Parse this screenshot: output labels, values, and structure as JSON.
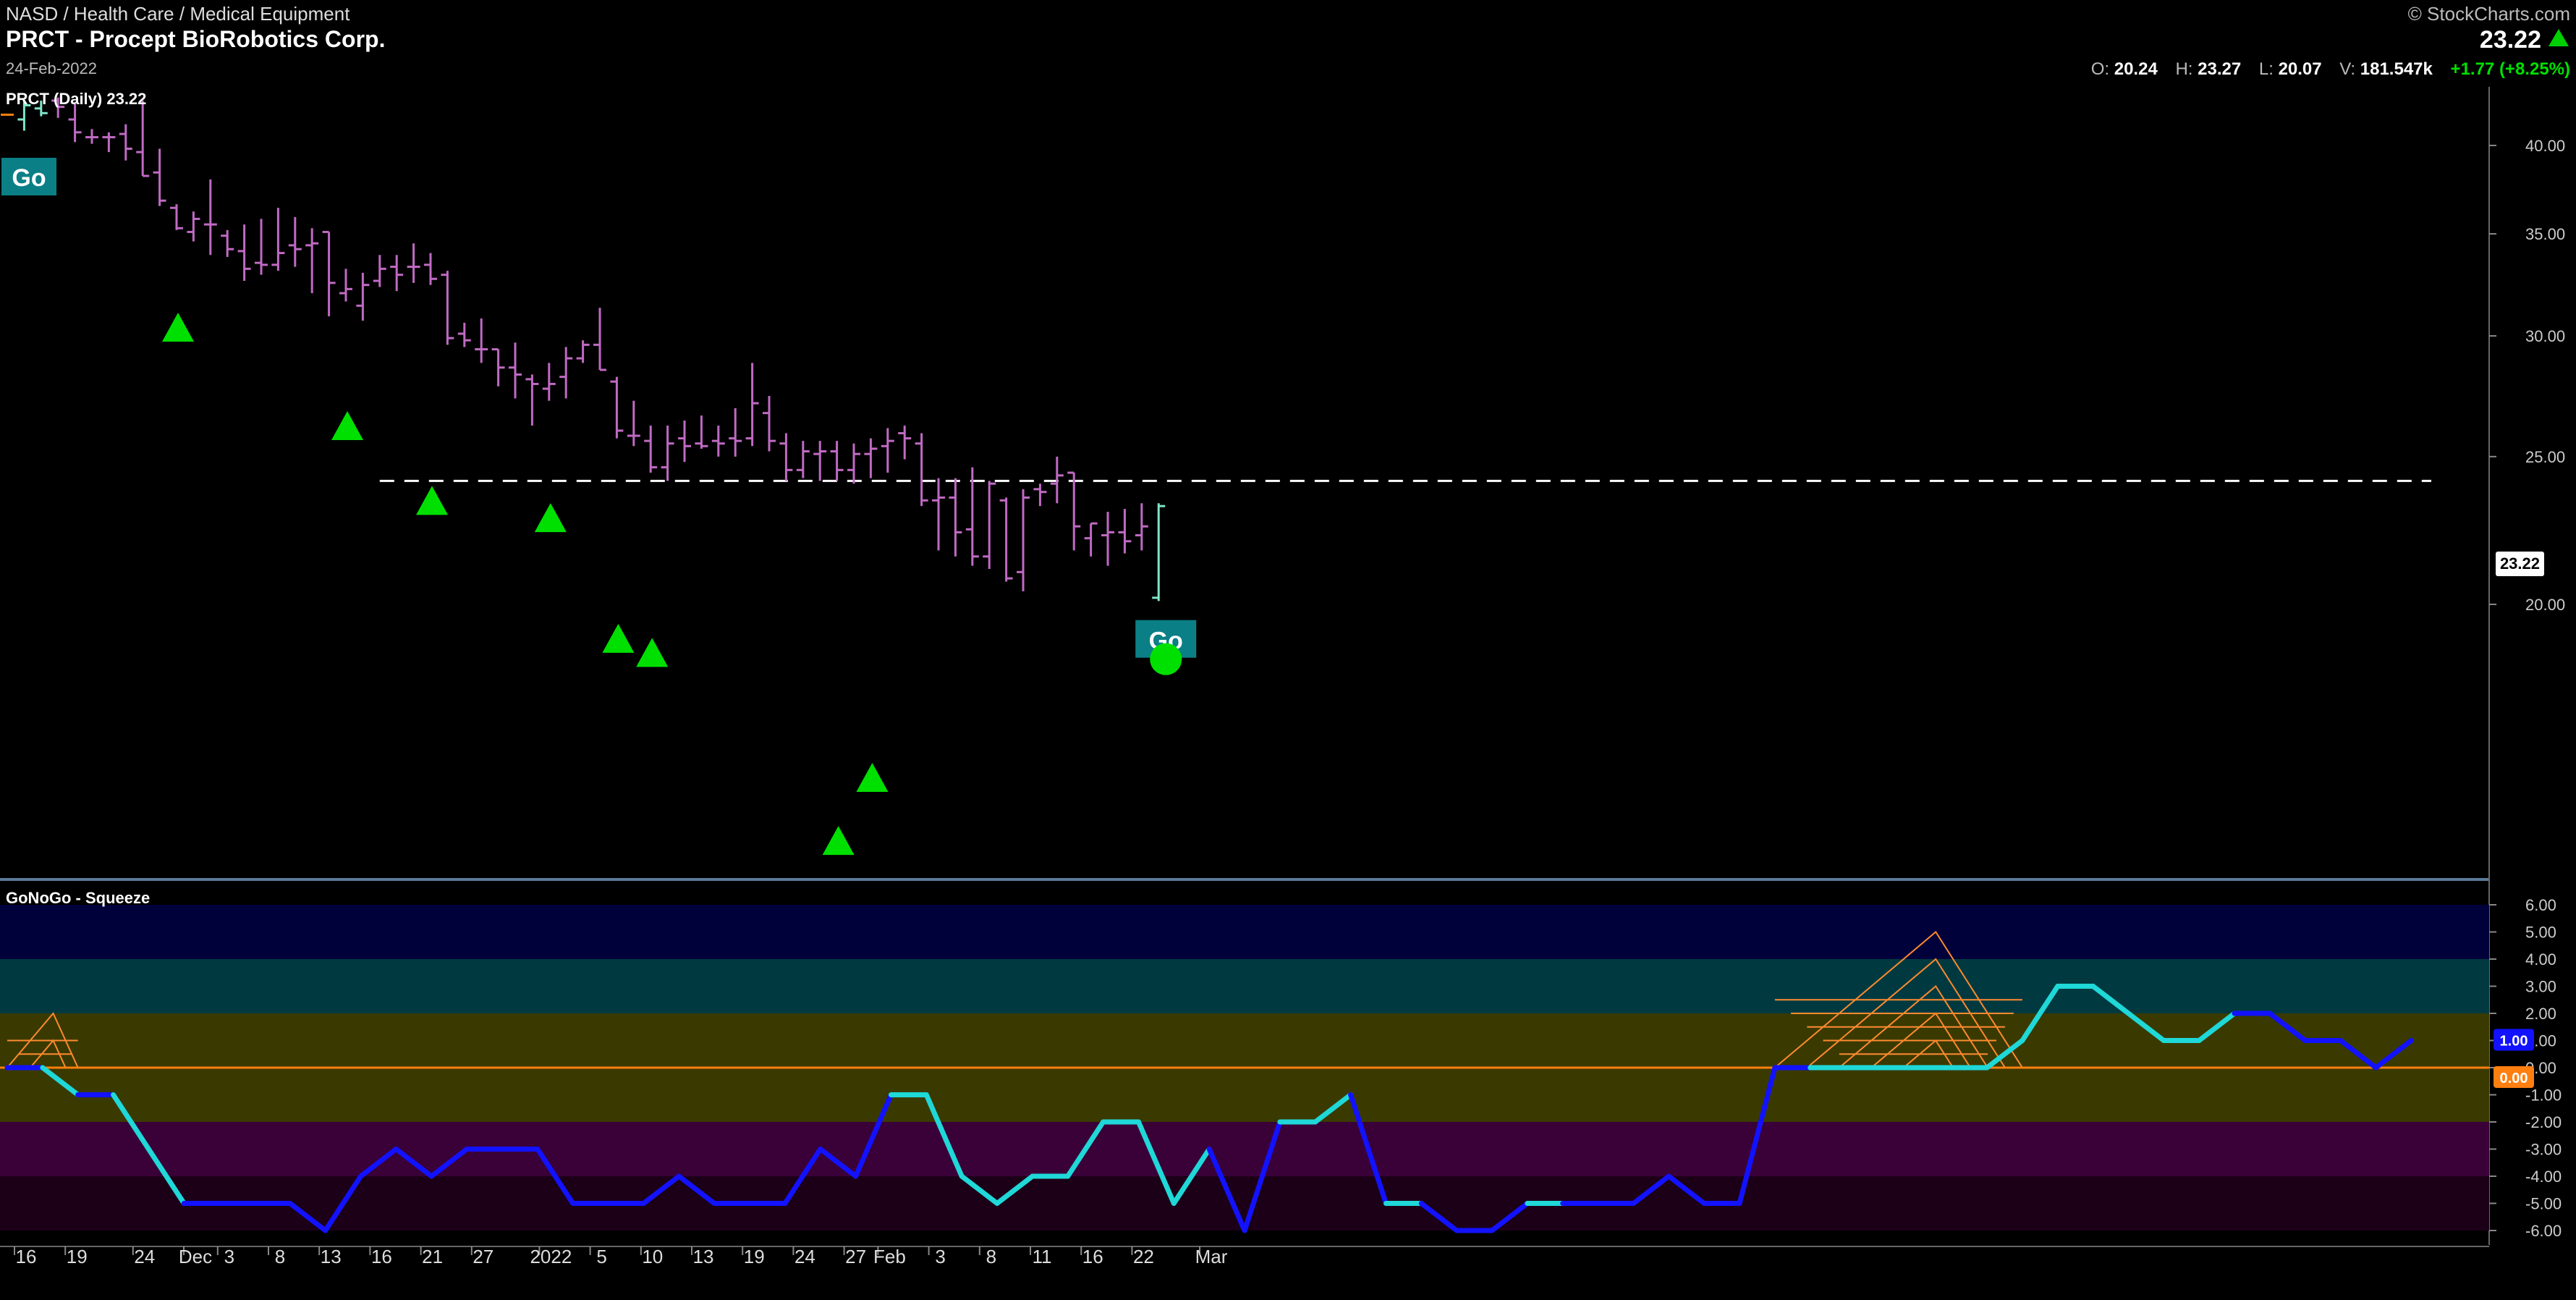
{
  "header": {
    "breadcrumb": "NASD / Health Care / Medical Equipment",
    "title": "PRCT - Procept BioRobotics Corp.",
    "date": "24-Feb-2022",
    "brand": "© StockCharts.com",
    "last_price": "23.22",
    "ohlcv": {
      "open_label": "O:",
      "open": "20.24",
      "high_label": "H:",
      "high": "23.27",
      "low_label": "L:",
      "low": "20.07",
      "volume_label": "V:",
      "volume": "181.547k",
      "change": "+1.77 (+8.25%)"
    }
  },
  "price_panel": {
    "label": "PRCT (Daily) 23.22",
    "go_badge": "Go",
    "last_price_box": "23.22"
  },
  "oscillator_panel": {
    "label": "GoNoGo - Squeeze",
    "value_box": "1.00",
    "zero_box": "0.00"
  },
  "colors": {
    "bar_pink": "#c06ac4",
    "bar_pink_light": "#e79ae6",
    "bar_aqua": "#7fe6c8",
    "go_badge": "#0b7f86",
    "triangle": "#00e000",
    "osc_blue": "#1212ff",
    "osc_cyan": "#1fd8d8",
    "zero_line": "#ff7f10",
    "squeeze": "#ff8a30"
  },
  "chart_data": [
    {
      "type": "ohlc",
      "title": "PRCT (Daily) 23.22",
      "x_tick_labels": [
        "16",
        "19",
        "24",
        "Dec",
        "3",
        "8",
        "13",
        "16",
        "21",
        "27",
        "2022",
        "5",
        "10",
        "13",
        "19",
        "24",
        "27",
        "Feb",
        "3",
        "8",
        "11",
        "16",
        "22",
        "Mar"
      ],
      "y_ticks": [
        "20.00",
        "25.00",
        "30.00",
        "35.00",
        "40.00"
      ],
      "y_scale": "log",
      "ylim": [
        13.2,
        43.7
      ],
      "resistance_line": 24.1,
      "bars": [
        {
          "date": "2021-11-16",
          "o": 41.9,
          "h": 41.9,
          "l": 41.9,
          "c": 41.9,
          "color": "orange"
        },
        {
          "date": "2021-11-17",
          "o": 41.6,
          "h": 42.8,
          "l": 40.9,
          "c": 42.5,
          "color": "aqua"
        },
        {
          "date": "2021-11-18",
          "o": 42.3,
          "h": 42.8,
          "l": 41.8,
          "c": 42.0,
          "color": "aqua"
        },
        {
          "date": "2021-11-19",
          "o": 42.8,
          "h": 43.0,
          "l": 41.7,
          "c": 42.4,
          "color": "pink"
        },
        {
          "date": "2021-11-22",
          "o": 41.6,
          "h": 42.7,
          "l": 40.2,
          "c": 40.8,
          "color": "pink"
        },
        {
          "date": "2021-11-23",
          "o": 40.5,
          "h": 41.0,
          "l": 40.1,
          "c": 40.5,
          "color": "pink"
        },
        {
          "date": "2021-11-24",
          "o": 40.5,
          "h": 40.8,
          "l": 39.6,
          "c": 40.5,
          "color": "pink"
        },
        {
          "date": "2021-11-26",
          "o": 40.7,
          "h": 41.3,
          "l": 39.1,
          "c": 39.8,
          "color": "pink"
        },
        {
          "date": "2021-11-29",
          "o": 39.6,
          "h": 42.8,
          "l": 38.2,
          "c": 38.2,
          "color": "pink"
        },
        {
          "date": "2021-11-30",
          "o": 38.4,
          "h": 39.8,
          "l": 36.5,
          "c": 36.8,
          "color": "pink"
        },
        {
          "date": "2021-12-01",
          "o": 36.4,
          "h": 36.6,
          "l": 35.2,
          "c": 35.3,
          "color": "pink"
        },
        {
          "date": "2021-12-02",
          "o": 35.1,
          "h": 36.2,
          "l": 34.6,
          "c": 35.8,
          "color": "pink"
        },
        {
          "date": "2021-12-03",
          "o": 35.5,
          "h": 38.0,
          "l": 33.9,
          "c": 35.5,
          "color": "pink"
        },
        {
          "date": "2021-12-06",
          "o": 34.9,
          "h": 35.2,
          "l": 33.8,
          "c": 34.2,
          "color": "pink"
        },
        {
          "date": "2021-12-07",
          "o": 34.1,
          "h": 35.5,
          "l": 32.6,
          "c": 33.2,
          "color": "pink"
        },
        {
          "date": "2021-12-08",
          "o": 33.5,
          "h": 35.8,
          "l": 32.9,
          "c": 33.4,
          "color": "pink"
        },
        {
          "date": "2021-12-09",
          "o": 33.4,
          "h": 36.4,
          "l": 33.1,
          "c": 34.0,
          "color": "pink"
        },
        {
          "date": "2021-12-10",
          "o": 34.4,
          "h": 35.9,
          "l": 33.3,
          "c": 34.2,
          "color": "pink"
        },
        {
          "date": "2021-12-13",
          "o": 34.4,
          "h": 35.3,
          "l": 32.0,
          "c": 34.5,
          "color": "pink"
        },
        {
          "date": "2021-12-14",
          "o": 35.1,
          "h": 35.1,
          "l": 30.9,
          "c": 32.5,
          "color": "pink"
        },
        {
          "date": "2021-12-15",
          "o": 32.0,
          "h": 33.2,
          "l": 31.6,
          "c": 32.2,
          "color": "pink"
        },
        {
          "date": "2021-12-16",
          "o": 31.4,
          "h": 33.0,
          "l": 30.7,
          "c": 32.4,
          "color": "pink"
        },
        {
          "date": "2021-12-17",
          "o": 32.6,
          "h": 33.9,
          "l": 32.3,
          "c": 33.2,
          "color": "pink"
        },
        {
          "date": "2021-12-20",
          "o": 33.3,
          "h": 33.9,
          "l": 32.1,
          "c": 32.9,
          "color": "pink"
        },
        {
          "date": "2021-12-21",
          "o": 33.3,
          "h": 34.5,
          "l": 32.5,
          "c": 33.3,
          "color": "pink"
        },
        {
          "date": "2021-12-22",
          "o": 33.4,
          "h": 34.0,
          "l": 32.4,
          "c": 32.7,
          "color": "pink"
        },
        {
          "date": "2021-12-23",
          "o": 32.9,
          "h": 33.1,
          "l": 29.6,
          "c": 29.9,
          "color": "pink"
        },
        {
          "date": "2021-12-27",
          "o": 30.1,
          "h": 30.6,
          "l": 29.5,
          "c": 29.8,
          "color": "pink"
        },
        {
          "date": "2021-12-28",
          "o": 29.4,
          "h": 30.8,
          "l": 28.8,
          "c": 29.4,
          "color": "pink"
        },
        {
          "date": "2021-12-29",
          "o": 29.4,
          "h": 29.4,
          "l": 27.8,
          "c": 28.6,
          "color": "pink"
        },
        {
          "date": "2021-12-30",
          "o": 28.6,
          "h": 29.7,
          "l": 27.3,
          "c": 28.3,
          "color": "pink"
        },
        {
          "date": "2021-12-31",
          "o": 28.1,
          "h": 28.3,
          "l": 26.2,
          "c": 27.9,
          "color": "pink"
        },
        {
          "date": "2022-01-03",
          "o": 27.7,
          "h": 28.8,
          "l": 27.2,
          "c": 27.9,
          "color": "pink"
        },
        {
          "date": "2022-01-04",
          "o": 28.2,
          "h": 29.5,
          "l": 27.3,
          "c": 29.0,
          "color": "pink"
        },
        {
          "date": "2022-01-05",
          "o": 29.0,
          "h": 29.8,
          "l": 28.8,
          "c": 29.6,
          "color": "pink"
        },
        {
          "date": "2022-01-06",
          "o": 29.6,
          "h": 31.3,
          "l": 28.5,
          "c": 28.5,
          "color": "pink"
        },
        {
          "date": "2022-01-07",
          "o": 28.0,
          "h": 28.2,
          "l": 25.7,
          "c": 26.0,
          "color": "pink"
        },
        {
          "date": "2022-01-10",
          "o": 25.8,
          "h": 27.2,
          "l": 25.4,
          "c": 25.8,
          "color": "pink"
        },
        {
          "date": "2022-01-11",
          "o": 25.6,
          "h": 26.2,
          "l": 24.4,
          "c": 24.6,
          "color": "pink"
        },
        {
          "date": "2022-01-12",
          "o": 24.6,
          "h": 26.2,
          "l": 24.1,
          "c": 25.5,
          "color": "pink"
        },
        {
          "date": "2022-01-13",
          "o": 25.7,
          "h": 26.4,
          "l": 24.8,
          "c": 25.4,
          "color": "pink"
        },
        {
          "date": "2022-01-14",
          "o": 25.5,
          "h": 26.6,
          "l": 25.3,
          "c": 25.4,
          "color": "pink"
        },
        {
          "date": "2022-01-18",
          "o": 25.6,
          "h": 26.2,
          "l": 25.0,
          "c": 25.5,
          "color": "pink"
        },
        {
          "date": "2022-01-19",
          "o": 25.7,
          "h": 26.9,
          "l": 25.0,
          "c": 25.6,
          "color": "pink"
        },
        {
          "date": "2022-01-20",
          "o": 25.7,
          "h": 28.8,
          "l": 25.4,
          "c": 27.1,
          "color": "pink"
        },
        {
          "date": "2022-01-21",
          "o": 26.7,
          "h": 27.4,
          "l": 25.2,
          "c": 25.6,
          "color": "pink"
        },
        {
          "date": "2022-01-24",
          "o": 25.5,
          "h": 25.9,
          "l": 24.1,
          "c": 24.5,
          "color": "pink"
        },
        {
          "date": "2022-01-25",
          "o": 24.5,
          "h": 25.6,
          "l": 24.2,
          "c": 25.2,
          "color": "pink"
        },
        {
          "date": "2022-01-26",
          "o": 25.1,
          "h": 25.6,
          "l": 24.1,
          "c": 25.2,
          "color": "pink"
        },
        {
          "date": "2022-01-27",
          "o": 25.2,
          "h": 25.6,
          "l": 24.1,
          "c": 24.5,
          "color": "pink"
        },
        {
          "date": "2022-01-28",
          "o": 24.5,
          "h": 25.5,
          "l": 24.0,
          "c": 25.1,
          "color": "pink"
        },
        {
          "date": "2022-01-31",
          "o": 25.1,
          "h": 25.7,
          "l": 24.2,
          "c": 25.3,
          "color": "pink"
        },
        {
          "date": "2022-02-01",
          "o": 25.4,
          "h": 26.1,
          "l": 24.4,
          "c": 25.6,
          "color": "pink"
        },
        {
          "date": "2022-02-02",
          "o": 25.9,
          "h": 26.2,
          "l": 24.9,
          "c": 25.7,
          "color": "pink"
        },
        {
          "date": "2022-02-03",
          "o": 25.5,
          "h": 25.9,
          "l": 23.2,
          "c": 23.4,
          "color": "pink"
        },
        {
          "date": "2022-02-04",
          "o": 23.4,
          "h": 24.2,
          "l": 21.7,
          "c": 23.5,
          "color": "pink"
        },
        {
          "date": "2022-02-07",
          "o": 23.5,
          "h": 24.2,
          "l": 21.5,
          "c": 22.3,
          "color": "pink"
        },
        {
          "date": "2022-02-08",
          "o": 22.4,
          "h": 24.6,
          "l": 21.2,
          "c": 21.5,
          "color": "pink"
        },
        {
          "date": "2022-02-09",
          "o": 21.5,
          "h": 24.1,
          "l": 21.1,
          "c": 24.0,
          "color": "pink"
        },
        {
          "date": "2022-02-10",
          "o": 23.4,
          "h": 23.5,
          "l": 20.7,
          "c": 20.8,
          "color": "pink"
        },
        {
          "date": "2022-02-11",
          "o": 21.0,
          "h": 23.8,
          "l": 20.4,
          "c": 23.5,
          "color": "pink"
        },
        {
          "date": "2022-02-14",
          "o": 23.8,
          "h": 24.0,
          "l": 23.2,
          "c": 23.7,
          "color": "pink"
        },
        {
          "date": "2022-02-15",
          "o": 24.0,
          "h": 25.0,
          "l": 23.3,
          "c": 24.3,
          "color": "pink"
        },
        {
          "date": "2022-02-16",
          "o": 24.4,
          "h": 24.4,
          "l": 21.7,
          "c": 22.5,
          "color": "pink"
        },
        {
          "date": "2022-02-17",
          "o": 22.1,
          "h": 22.6,
          "l": 21.5,
          "c": 22.6,
          "color": "pink"
        },
        {
          "date": "2022-02-18",
          "o": 22.2,
          "h": 23.0,
          "l": 21.2,
          "c": 22.3,
          "color": "pink"
        },
        {
          "date": "2022-02-22",
          "o": 22.3,
          "h": 23.1,
          "l": 21.6,
          "c": 22.0,
          "color": "pink"
        },
        {
          "date": "2022-02-23",
          "o": 22.2,
          "h": 23.3,
          "l": 21.7,
          "c": 22.5,
          "color": "pink"
        },
        {
          "date": "2022-02-24",
          "o": 20.2,
          "h": 23.3,
          "l": 20.1,
          "c": 23.2,
          "color": "aqua"
        }
      ],
      "triangles": [
        {
          "date": "2021-12-01",
          "y": 30.4
        },
        {
          "date": "2021-12-15",
          "y": 26.2
        },
        {
          "date": "2021-12-22",
          "y": 23.4
        },
        {
          "date": "2022-01-03",
          "y": 22.8
        },
        {
          "date": "2022-01-07",
          "y": 19.0
        },
        {
          "date": "2022-01-11",
          "y": 18.6
        },
        {
          "date": "2022-01-27",
          "y": 14.0
        },
        {
          "date": "2022-01-31",
          "y": 15.4
        }
      ],
      "go_marker": {
        "date": "2022-02-24",
        "y": 18.9,
        "text": "Go"
      }
    },
    {
      "type": "line",
      "title": "GoNoGo - Squeeze",
      "y_ticks": [
        "6.00",
        "5.00",
        "4.00",
        "3.00",
        "2.00",
        "1.00",
        "0.00",
        "-1.00",
        "-2.00",
        "-3.00",
        "-4.00",
        "-5.00",
        "-6.00"
      ],
      "ylim": [
        -6,
        6
      ],
      "series": [
        {
          "values": [
            [
              0,
              0
            ],
            [
              1,
              0
            ],
            [
              2,
              -1
            ],
            [
              3,
              -1
            ],
            [
              4,
              -3
            ],
            [
              5,
              -5
            ],
            [
              6,
              -5
            ],
            [
              7,
              -5
            ],
            [
              8,
              -5
            ],
            [
              9,
              -6
            ],
            [
              10,
              -4
            ],
            [
              11,
              -3
            ],
            [
              12,
              -4
            ],
            [
              13,
              -3
            ],
            [
              14,
              -3
            ],
            [
              15,
              -3
            ],
            [
              16,
              -5
            ],
            [
              17,
              -5
            ],
            [
              18,
              -5
            ],
            [
              19,
              -4
            ],
            [
              20,
              -5
            ],
            [
              21,
              -5
            ],
            [
              22,
              -5
            ],
            [
              23,
              -3
            ],
            [
              24,
              -4
            ],
            [
              25,
              -1
            ],
            [
              26,
              -1
            ],
            [
              27,
              -4
            ],
            [
              28,
              -5
            ],
            [
              29,
              -4
            ],
            [
              30,
              -4
            ],
            [
              31,
              -2
            ],
            [
              32,
              -2
            ],
            [
              33,
              -5
            ],
            [
              34,
              -3
            ],
            [
              35,
              -6
            ],
            [
              36,
              -2
            ],
            [
              37,
              -2
            ],
            [
              38,
              -1
            ],
            [
              39,
              -5
            ],
            [
              40,
              -5
            ],
            [
              41,
              -6
            ],
            [
              42,
              -6
            ],
            [
              43,
              -5
            ],
            [
              44,
              -5
            ],
            [
              45,
              -5
            ],
            [
              46,
              -5
            ],
            [
              47,
              -4
            ],
            [
              48,
              -5
            ],
            [
              49,
              -5
            ],
            [
              50,
              0
            ],
            [
              51,
              0
            ],
            [
              52,
              0
            ],
            [
              53,
              0
            ],
            [
              54,
              0
            ],
            [
              55,
              0
            ],
            [
              56,
              0
            ],
            [
              57,
              1
            ],
            [
              58,
              3
            ],
            [
              59,
              3
            ],
            [
              60,
              2
            ],
            [
              61,
              1
            ],
            [
              62,
              1
            ],
            [
              63,
              2
            ],
            [
              64,
              2
            ],
            [
              65,
              1
            ],
            [
              66,
              1
            ],
            [
              67,
              0
            ],
            [
              68,
              1
            ]
          ]
        }
      ],
      "segment_colors": [
        "blue",
        "cyan",
        "blue",
        "cyan",
        "cyan",
        "blue",
        "blue",
        "blue",
        "blue",
        "blue",
        "blue",
        "blue",
        "blue",
        "blue",
        "blue",
        "blue",
        "blue",
        "blue",
        "blue",
        "blue",
        "blue",
        "blue",
        "blue",
        "blue",
        "blue",
        "cyan",
        "cyan",
        "cyan",
        "cyan",
        "cyan",
        "cyan",
        "cyan",
        "cyan",
        "cyan",
        "blue",
        "blue",
        "cyan",
        "cyan",
        "blue",
        "cyan",
        "blue",
        "blue",
        "blue",
        "cyan",
        "blue",
        "blue",
        "blue",
        "blue",
        "blue",
        "blue",
        "blue",
        "cyan",
        "cyan",
        "cyan",
        "cyan",
        "cyan",
        "cyan",
        "cyan",
        "cyan",
        "cyan",
        "cyan",
        "cyan",
        "cyan",
        "blue",
        "blue",
        "blue",
        "blue",
        "blue"
      ],
      "zero_line": 0,
      "squeeze_peaks": [
        {
          "start": 0,
          "end": 2,
          "level": 2
        },
        {
          "start": 50,
          "end": 57,
          "level": 5
        }
      ]
    }
  ]
}
